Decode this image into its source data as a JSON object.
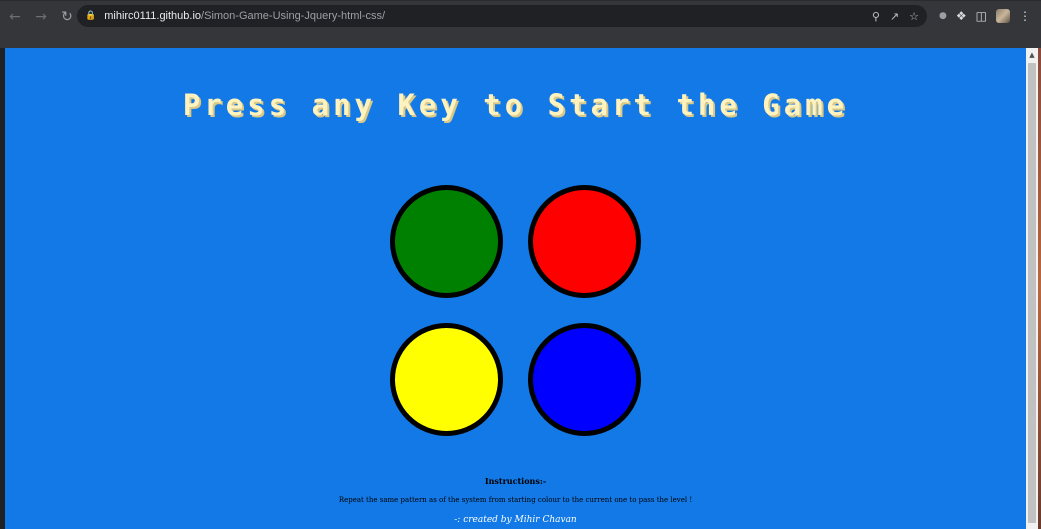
{
  "browser": {
    "url_host": "mihirc0111.github.io",
    "url_path": "/Simon-Game-Using-Jquery-html-css/",
    "icons": {
      "back": "back-arrow-icon",
      "forward": "forward-arrow-icon",
      "reload": "reload-icon",
      "lock": "lock-icon",
      "zoom": "zoom-icon",
      "share": "share-icon",
      "bookmark": "star-icon",
      "extension": "puzzle-icon",
      "sidepanel": "side-panel-icon",
      "menu": "kebab-menu-icon"
    }
  },
  "game": {
    "title": "Press any Key to Start the Game",
    "buttons": [
      {
        "id": "green",
        "color": "#008000"
      },
      {
        "id": "red",
        "color": "#ff0000"
      },
      {
        "id": "yellow",
        "color": "#ffff00"
      },
      {
        "id": "blue",
        "color": "#0000ff"
      }
    ],
    "background_color": "#1279e6",
    "title_color": "#fef2bf"
  },
  "instructions": {
    "heading": "Instructions:-",
    "text": "Repeat the same pattern as of the system from starting colour to the current one to pass the level !",
    "credit": "-: created by Mihir Chavan"
  }
}
